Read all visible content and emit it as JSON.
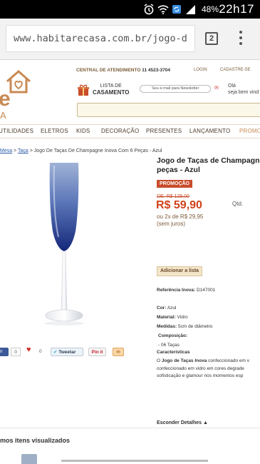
{
  "status_bar": {
    "battery": "48%",
    "time": "22h17"
  },
  "browser": {
    "url": "www.habitarecasa.com.br/jogo-d",
    "tab_count": "2"
  },
  "header": {
    "logo_letter": "e",
    "logo_sub": "A",
    "central_label": "CENTRAL DE ATENDIMENTO",
    "phone": "11 4523-3704",
    "login": "LOGIN",
    "cadastre": "CADASTRE-SE",
    "lista_line1": "LISTA DE",
    "lista_line2": "CASAMENTO",
    "newsletter_placeholder": "Seu e-mail para Newsletter",
    "welcome_line1": "Olá",
    "welcome_line2": "seja bem vind"
  },
  "nav": [
    "UTILIDADES",
    "ELETROS",
    "KIDS",
    "DECORAÇÃO",
    "PRESENTES",
    "LANÇAMENTO",
    "PROMO"
  ],
  "breadcrumb": {
    "items": [
      "Mesa",
      "Taça"
    ],
    "separator": ">",
    "current": "Jogo De Taças De Champagne Inova Com 6 Peças - Azul"
  },
  "product": {
    "title_line1": "Jogo de Taças de Champagn",
    "title_line2": "peças - Azul",
    "promo_badge": "PROMOÇÃO",
    "old_price": "DE: R$ 129,00",
    "price": "R$ 59,90",
    "installment_line1": "ou 2x de R$ 29,95",
    "installment_line2": "(sem juros)",
    "qty_label": "Qtd.",
    "add_list": "Adicionar a lista",
    "ref_label": "Referência Inova:",
    "ref_value": "D147001",
    "cor_label": "Cor:",
    "cor_value": "Azul",
    "material_label": "Material:",
    "material_value": "Vidro",
    "medidas_label": "Medidas:",
    "medidas_value": "5cm de diâmetro",
    "composicao_label": "Composição:",
    "composicao_value": "- 06 Taças",
    "caracteristicas_label": "Características",
    "desc_line1_pre": "O ",
    "desc_line1_bold": "Jogo de Taças Inova",
    "desc_line1_post": " confeccionado em v",
    "desc_line2": "confeccionado em vidro em cores degrade",
    "desc_line3": "sofisticação e glamour nos momentos esp",
    "hide_details": "Esconder Detalhes"
  },
  "social": {
    "fb_label": "ir",
    "fb_count": "0",
    "heart_count": "0",
    "tweet_label": "Tweetar",
    "pin_label": "Pin it"
  },
  "recent": {
    "title": "mos itens visualizados"
  },
  "colors": {
    "accent": "#c88a54",
    "price": "#d0421a",
    "promo": "#c94c2c",
    "glass": "#1f3b8f"
  }
}
